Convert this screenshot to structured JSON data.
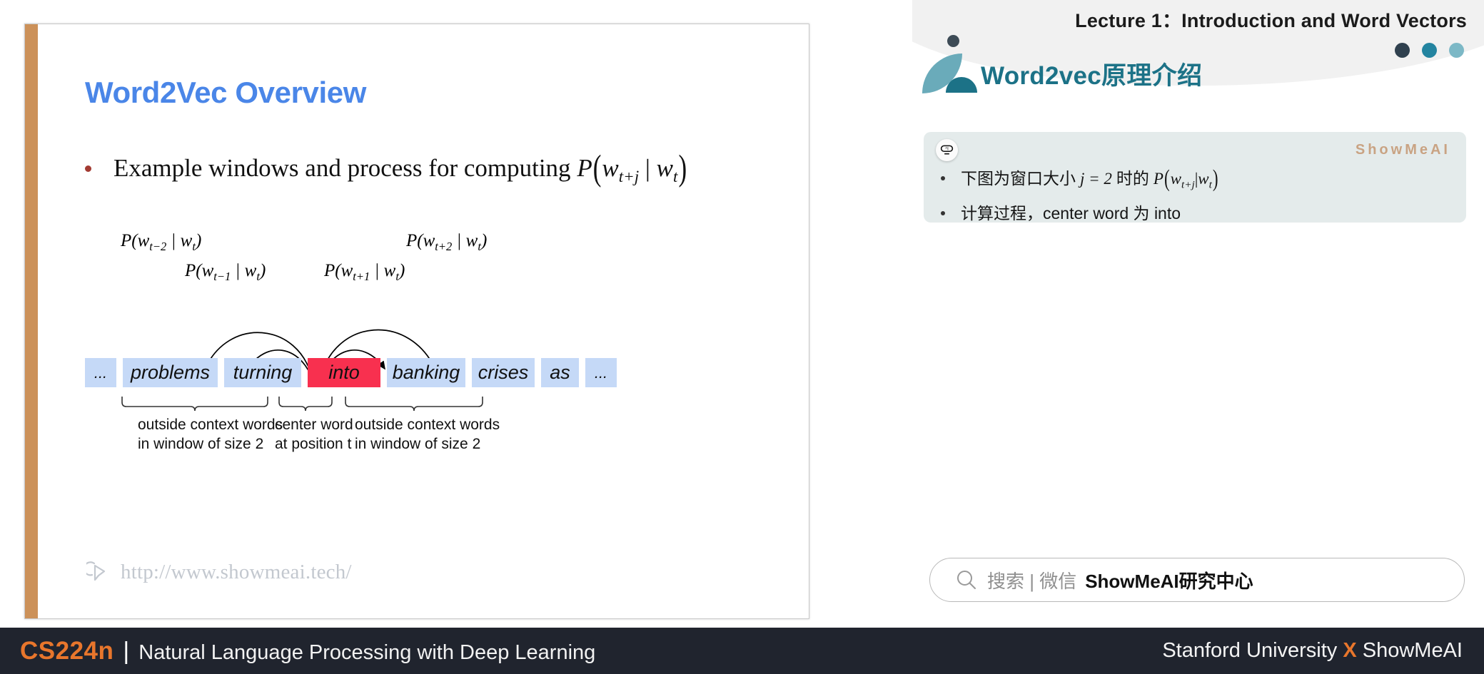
{
  "slide": {
    "title": "Word2Vec Overview",
    "bullet": {
      "prefix": "Example windows and process for computing ",
      "formula_plain": "P(w_t+j | w_t)"
    },
    "diagram": {
      "arc_labels": [
        "P(w_{t-2} | w_t)",
        "P(w_{t-1} | w_t)",
        "P(w_{t+1} | w_t)",
        "P(w_{t+2} | w_t)"
      ],
      "words": [
        {
          "text": "...",
          "role": "ellipsis"
        },
        {
          "text": "problems",
          "role": "outside"
        },
        {
          "text": "turning",
          "role": "outside"
        },
        {
          "text": "into",
          "role": "center"
        },
        {
          "text": "banking",
          "role": "outside"
        },
        {
          "text": "crises",
          "role": "outside"
        },
        {
          "text": "as",
          "role": "outside"
        },
        {
          "text": "...",
          "role": "ellipsis"
        }
      ],
      "brace_left_line1": "outside context words",
      "brace_left_line2": "in window of size 2",
      "brace_center_line1": "center word",
      "brace_center_line2": "at position t",
      "brace_right_line1": "outside context words",
      "brace_right_line2": "in window of size 2"
    },
    "watermark_url": "http://www.showmeai.tech/"
  },
  "right_panel": {
    "lecture_title": "Lecture 1：Introduction and Word Vectors",
    "panel_title": "Word2vec原理介绍",
    "brand": "ShowMeAI",
    "card_bullets": [
      "下图为窗口大小 j = 2 时的 P(w_t+j|w_t)",
      "计算过程，center word 为 into"
    ],
    "search": {
      "placeholder": "搜索 | 微信",
      "strong": "ShowMeAI研究中心"
    },
    "dot_colors": [
      "#30414f",
      "#2384a0",
      "#7cb8c6"
    ]
  },
  "bottom_bar": {
    "course_code": "CS224n",
    "separator": "|",
    "subtitle": "Natural Language Processing with Deep Learning",
    "right_prefix": "Stanford University ",
    "right_x": "X",
    "right_suffix": " ShowMeAI"
  },
  "colors": {
    "slide_title_blue": "#4a86e8",
    "accent_tan": "#cc9159",
    "word_box_blue": "#c5d9f7",
    "center_word_red": "#f8304f",
    "teal": "#1c7287",
    "orange": "#e8762c",
    "bar_dark": "#20242e"
  }
}
